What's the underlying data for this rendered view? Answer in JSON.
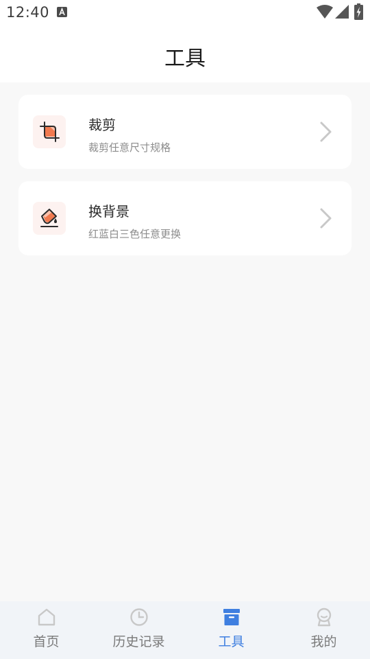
{
  "status_bar": {
    "time": "12:40",
    "notification_icon": "a-icon",
    "indicators": [
      "wifi-icon",
      "signal-icon",
      "battery-icon"
    ]
  },
  "header": {
    "title": "工具"
  },
  "tools": [
    {
      "title": "裁剪",
      "subtitle": "裁剪任意尺寸规格",
      "icon": "crop-icon"
    },
    {
      "title": "换背景",
      "subtitle": "红蓝白三色任意更换",
      "icon": "paint-bucket-icon"
    }
  ],
  "bottom_nav": {
    "items": [
      {
        "label": "首页",
        "icon": "home-icon",
        "active": false
      },
      {
        "label": "历史记录",
        "icon": "clock-icon",
        "active": false
      },
      {
        "label": "工具",
        "icon": "toolbox-icon",
        "active": true
      },
      {
        "label": "我的",
        "icon": "profile-icon",
        "active": false
      }
    ]
  },
  "colors": {
    "accent": "#3f7fe0",
    "icon_orange": "#f07a50",
    "icon_bg": "#fdf2f0",
    "inactive": "#c8c8c8",
    "page_bg": "#f8f8f8"
  }
}
